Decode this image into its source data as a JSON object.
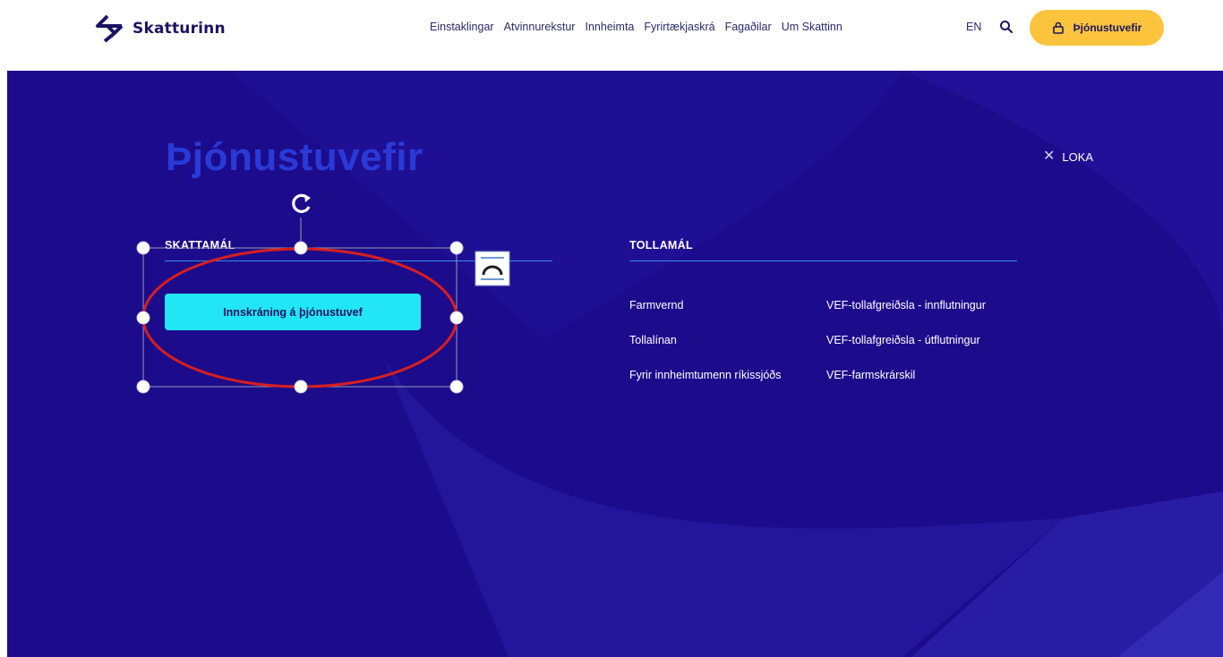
{
  "header": {
    "logo_text": "Skatturinn",
    "nav": [
      {
        "label": "Einstaklingar"
      },
      {
        "label": "Atvinnurekstur"
      },
      {
        "label": "Innheimta"
      },
      {
        "label": "Fyrirtækjaskrá"
      },
      {
        "label": "Fagaðilar"
      },
      {
        "label": "Um Skattinn"
      }
    ],
    "lang_label": "EN",
    "service_button_label": "Þjónustuvefir"
  },
  "page": {
    "title": "Þjónustuvefir",
    "close_label": "LOKA"
  },
  "skattamal": {
    "title": "SKATTAMÁL",
    "login_button_label": "Innskráning á þjónustuvef"
  },
  "tollamal": {
    "title": "TOLLAMÁL",
    "links_left": [
      "Farmvernd",
      "Tollalínan",
      "Fyrir innheimtumenn ríkissjóðs"
    ],
    "links_right": [
      "VEF-tollafgreiðsla - innflutningur",
      "VEF-tollafgreiðsla - útflutningur",
      "VEF-farmskrárskil"
    ]
  },
  "colors": {
    "panel_bg": "#1c0c8c",
    "accent_yellow": "#fcc43c",
    "accent_cyan": "#22e6f5",
    "title_blue": "#2a3ad6",
    "annotation_red": "#d81e1e"
  },
  "icons": {
    "logo": "skatturinn-logo-icon",
    "search": "search-icon",
    "lock": "lock-icon",
    "close": "close-icon",
    "rotate": "rotate-handle-icon",
    "layout": "text-wrap-layout-icon"
  }
}
